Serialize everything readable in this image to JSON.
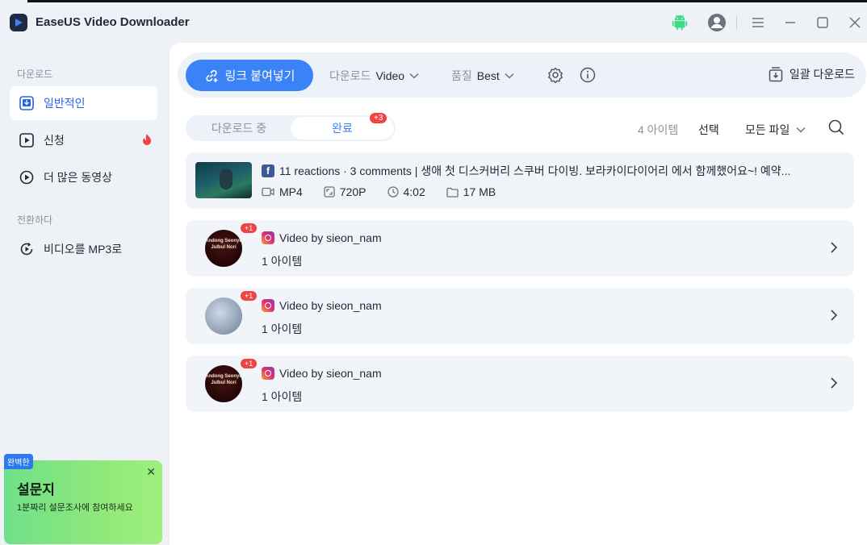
{
  "app": {
    "title": "EaseUS Video Downloader"
  },
  "sidebar": {
    "download_section": "다운로드",
    "convert_section": "전환하다",
    "items": [
      {
        "label": "일반적인",
        "icon": "download-box-icon",
        "active": true
      },
      {
        "label": "신청",
        "icon": "play-square-icon",
        "badge_icon": "fire-icon"
      },
      {
        "label": "더 많은 동영상",
        "icon": "play-circle-icon"
      },
      {
        "label": "비디오를 MP3로",
        "icon": "convert-icon"
      }
    ]
  },
  "promo": {
    "badge": "완벽한",
    "title": "설문지",
    "text": "1분짜리 설문조사에 참여하세요"
  },
  "toolbar": {
    "paste_label": "링크 붙여넣기",
    "download_prefix": "다운로드",
    "download_value": "Video",
    "quality_prefix": "품질",
    "quality_value": "Best",
    "batch_label": "일괄 다운로드"
  },
  "tabs": {
    "downloading": "다운로드 중",
    "completed": "완료",
    "completed_badge": "+3"
  },
  "list_header": {
    "count": "4 아이템",
    "select": "선택",
    "filter": "모든 파일"
  },
  "video": {
    "title": "11 reactions · 3 comments | 생애 첫 디스커버리 스쿠버 다이빙. 보라카이다이어리 에서 함께했어요~! 예약...",
    "format": "MP4",
    "resolution": "720P",
    "duration": "4:02",
    "size": "17 MB"
  },
  "groups": [
    {
      "title": "Video by sieon_nam",
      "count": "1 아이템",
      "badge": "+1",
      "avatar_text": "Andong Seonyu Julbul Nori"
    },
    {
      "title": "Video by sieon_nam",
      "count": "1 아이템",
      "badge": "+1",
      "avatar_text": ""
    },
    {
      "title": "Video by sieon_nam",
      "count": "1 아이템",
      "badge": "+1",
      "avatar_text": "Andong Seonyu Julbul Nori"
    }
  ],
  "colors": {
    "accent": "#3b82f6",
    "badge": "#ef4444",
    "promo": "#8fe87a"
  }
}
